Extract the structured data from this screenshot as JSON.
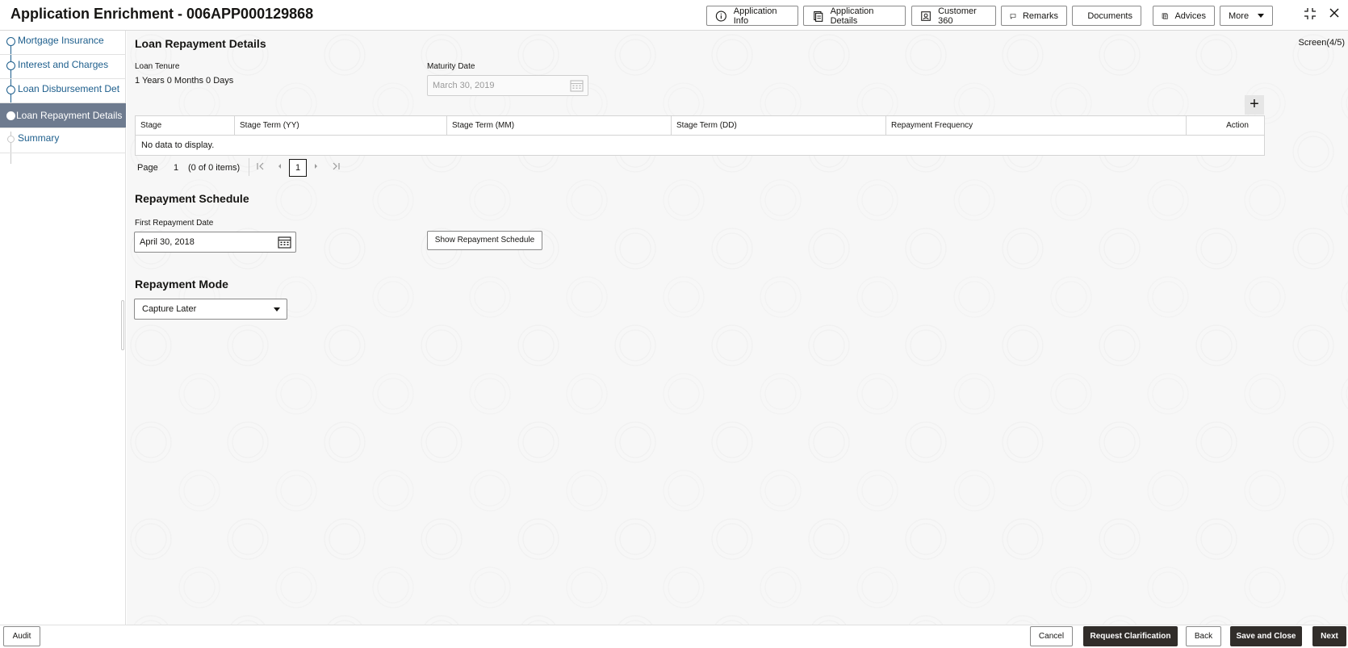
{
  "header": {
    "title": "Application Enrichment - 006APP000129868",
    "buttons": {
      "app_info": "Application Info",
      "app_details": "Application Details",
      "customer360": "Customer 360",
      "remarks": "Remarks",
      "documents": "Documents",
      "advices": "Advices",
      "more": "More"
    }
  },
  "sidebar": {
    "items": [
      {
        "label": "Mortgage Insurance"
      },
      {
        "label": "Interest and Charges"
      },
      {
        "label": "Loan Disbursement Det"
      },
      {
        "label": "Loan Repayment Details"
      },
      {
        "label": "Summary"
      }
    ]
  },
  "main": {
    "section_title": "Loan Repayment Details",
    "screen_indicator": "Screen(4/5)",
    "loan_tenure_label": "Loan Tenure",
    "loan_tenure_value": "1 Years 0 Months 0 Days",
    "maturity_date_label": "Maturity Date",
    "maturity_date_value": "March 30, 2019",
    "table": {
      "columns": [
        "Stage",
        "Stage Term (YY)",
        "Stage Term (MM)",
        "Stage Term (DD)",
        "Repayment Frequency",
        "Action"
      ],
      "empty_text": "No data to display."
    },
    "pagination": {
      "page_label": "Page",
      "page_number": "1",
      "items_text": "(0 of 0 items)",
      "current_page": "1"
    },
    "repayment_schedule": {
      "title": "Repayment Schedule",
      "first_date_label": "First Repayment Date",
      "first_date_value": "April 30, 2018",
      "show_button": "Show Repayment Schedule"
    },
    "repayment_mode": {
      "title": "Repayment Mode",
      "selected": "Capture Later"
    }
  },
  "footer": {
    "audit": "Audit",
    "cancel": "Cancel",
    "request_clarification": "Request Clarification",
    "back": "Back",
    "save_close": "Save and Close",
    "next": "Next"
  }
}
